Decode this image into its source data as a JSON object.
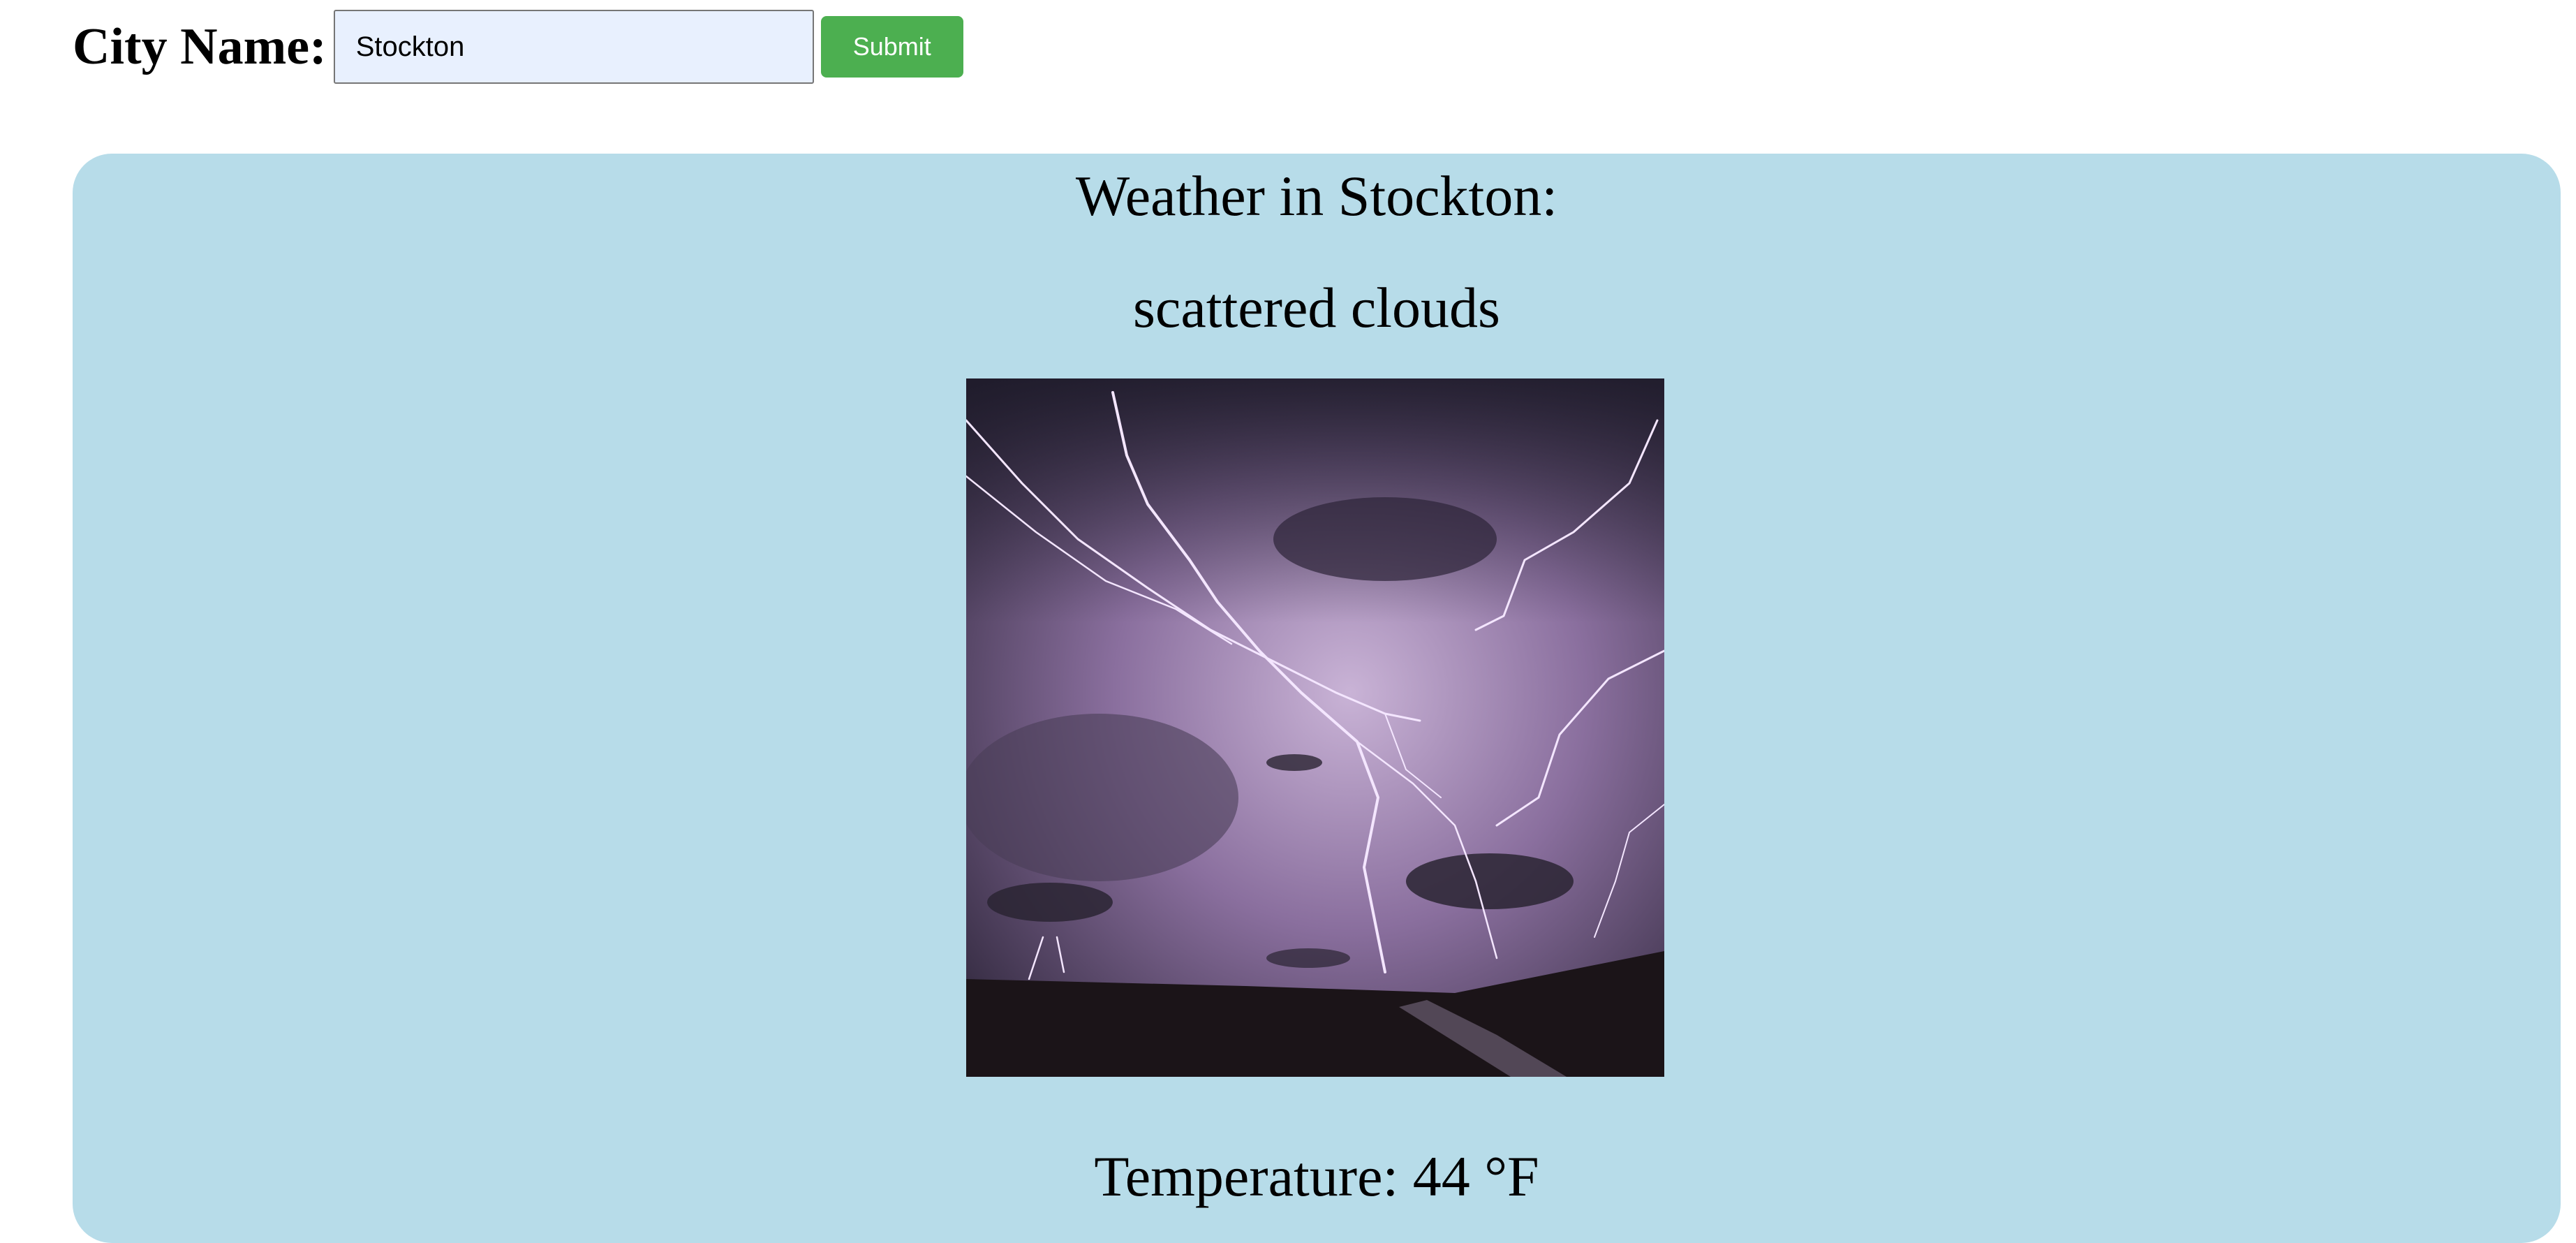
{
  "form": {
    "label": "City Name:",
    "input_value": "Stockton",
    "input_placeholder": "",
    "submit_label": "Submit"
  },
  "weather": {
    "title": "Weather in Stockton:",
    "description": "scattered clouds",
    "image_icon": "lightning-storm-photo",
    "temperature": "Temperature: 44 °F"
  },
  "colors": {
    "card_background": "#b7dce9",
    "input_background": "#e8f0fe",
    "submit_background": "#4caf50"
  }
}
